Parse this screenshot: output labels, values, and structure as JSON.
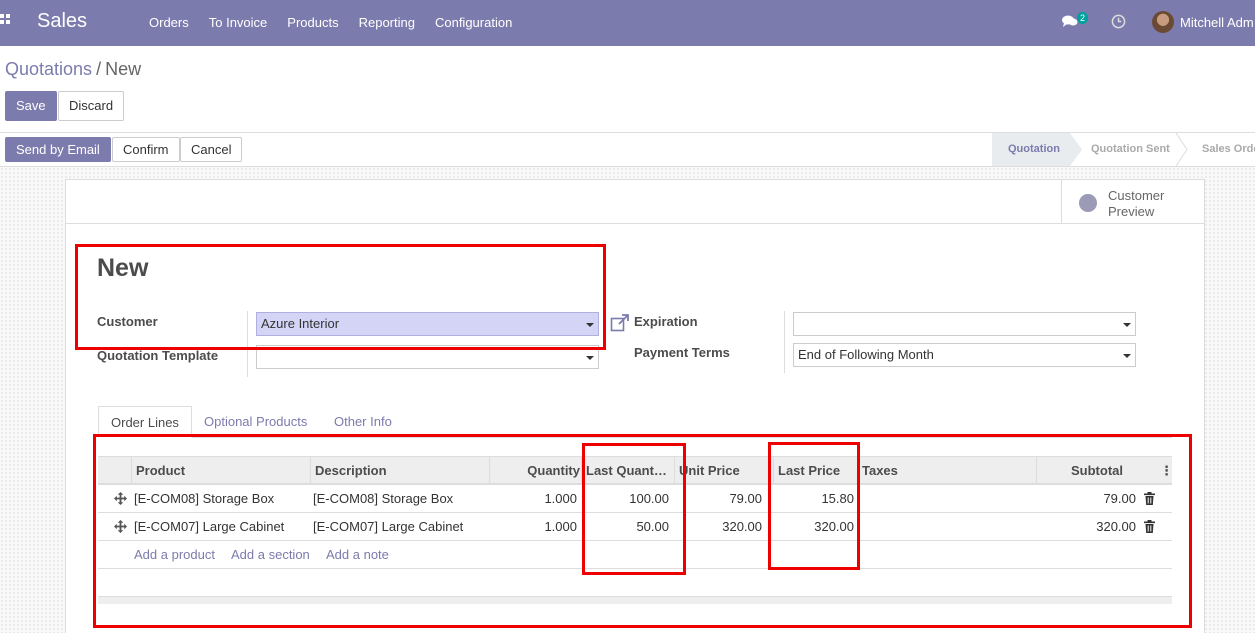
{
  "navbar": {
    "app_name": "Sales",
    "menu": [
      "Orders",
      "To Invoice",
      "Products",
      "Reporting",
      "Configuration"
    ],
    "chat_count": "2",
    "user_name": "Mitchell Adm"
  },
  "breadcrumb": {
    "parent": "Quotations",
    "separator": "/",
    "current": "New"
  },
  "buttons": {
    "save": "Save",
    "discard": "Discard",
    "send_email": "Send by Email",
    "confirm": "Confirm",
    "cancel": "Cancel"
  },
  "statusbar": [
    "Quotation",
    "Quotation Sent",
    "Sales Orde"
  ],
  "preview": {
    "line1": "Customer",
    "line2": "Preview"
  },
  "form": {
    "title": "New",
    "customer_label": "Customer",
    "customer_value": "Azure Interior",
    "template_label": "Quotation Template",
    "template_value": "",
    "expiration_label": "Expiration",
    "expiration_value": "",
    "payment_terms_label": "Payment Terms",
    "payment_terms_value": "End of Following Month"
  },
  "tabs": [
    "Order Lines",
    "Optional Products",
    "Other Info"
  ],
  "table": {
    "headers": [
      "Product",
      "Description",
      "Quantity",
      "Last Quant…",
      "Unit Price",
      "Last Price",
      "Taxes",
      "Subtotal"
    ],
    "rows": [
      {
        "product": "[E-COM08] Storage Box",
        "description": "[E-COM08] Storage Box",
        "quantity": "1.000",
        "last_qty": "100.00",
        "unit_price": "79.00",
        "last_price": "15.80",
        "taxes": "",
        "subtotal": "79.00"
      },
      {
        "product": "[E-COM07] Large Cabinet",
        "description": "[E-COM07] Large Cabinet",
        "quantity": "1.000",
        "last_qty": "50.00",
        "unit_price": "320.00",
        "last_price": "320.00",
        "taxes": "",
        "subtotal": "320.00"
      }
    ],
    "add_links": [
      "Add a product",
      "Add a section",
      "Add a note"
    ]
  },
  "colors": {
    "brand": "#7c7bad",
    "annotation": "#e00000"
  }
}
